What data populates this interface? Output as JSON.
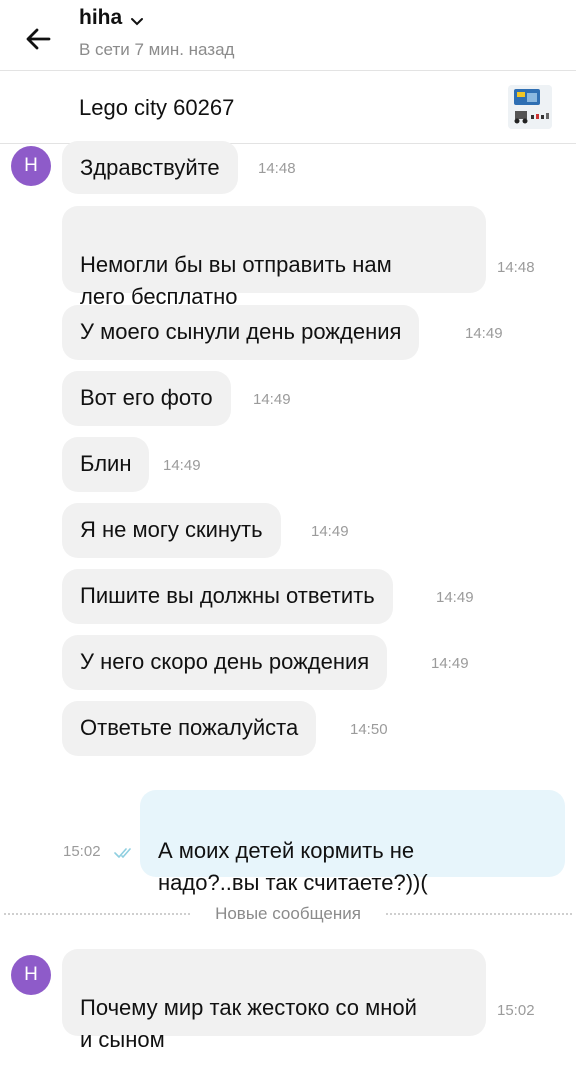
{
  "header": {
    "contact_name": "hiha",
    "status": "В сети 7 мин. назад"
  },
  "item": {
    "title": "Lego city 60267"
  },
  "avatar_letter": "Н",
  "messages": [
    {
      "text": "Здравствуйте",
      "time": "14:48"
    },
    {
      "text": "Немогли бы вы отправить нам\nлего бесплатно",
      "time": "14:48"
    },
    {
      "text": "У моего сынули день рождения",
      "time": "14:49"
    },
    {
      "text": "Вот его фото",
      "time": "14:49"
    },
    {
      "text": "Блин",
      "time": "14:49"
    },
    {
      "text": "Я не могу скинуть",
      "time": "14:49"
    },
    {
      "text": "Пишите вы должны ответить",
      "time": "14:49"
    },
    {
      "text": "У него скоро день рождения",
      "time": "14:49"
    },
    {
      "text": "Ответьте пожалуйста",
      "time": "14:50"
    }
  ],
  "outgoing": {
    "text": "А моих детей кормить не\nнадо?..вы так считаете?))(",
    "time": "15:02",
    "status_icon": "double-check-icon"
  },
  "divider": {
    "label": "Новые сообщения"
  },
  "new_message": {
    "text": "Почему мир так жестоко со мной\nи сыном",
    "time": "15:02"
  },
  "colors": {
    "avatar": "#8e5bc9",
    "incoming_bubble": "#f1f1f1",
    "outgoing_bubble": "#e7f5fb",
    "read_check": "#8fcfe0"
  }
}
